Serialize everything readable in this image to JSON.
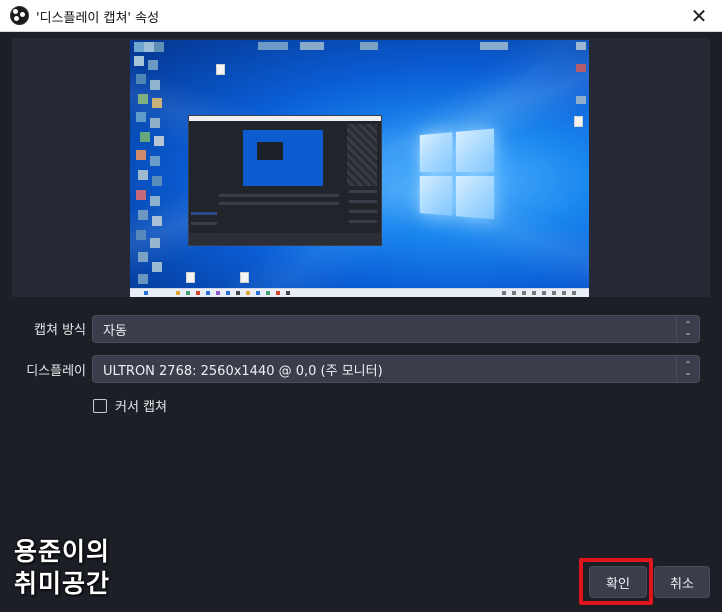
{
  "window": {
    "title": "'디스플레이 캡쳐' 속성",
    "close_label": "✕",
    "logo_icon": "obs-logo-icon"
  },
  "preview": {
    "wallpaper": "windows-10-blue",
    "accent": "#0b5ed6"
  },
  "form": {
    "capture_method": {
      "label": "캡쳐 방식",
      "value": "자동"
    },
    "display": {
      "label": "디스플레이",
      "value": "ULTRON 2768: 2560x1440 @ 0,0 (주 모니터)"
    },
    "cursor_capture": {
      "label": "커서 캡쳐",
      "checked": false
    }
  },
  "watermark": {
    "line1": "용준이의",
    "line2": "취미공간"
  },
  "buttons": {
    "ok": "확인",
    "cancel": "취소"
  },
  "colors": {
    "background": "#1d1f27",
    "control": "#3a3d4a",
    "highlight": "#e0141c"
  }
}
